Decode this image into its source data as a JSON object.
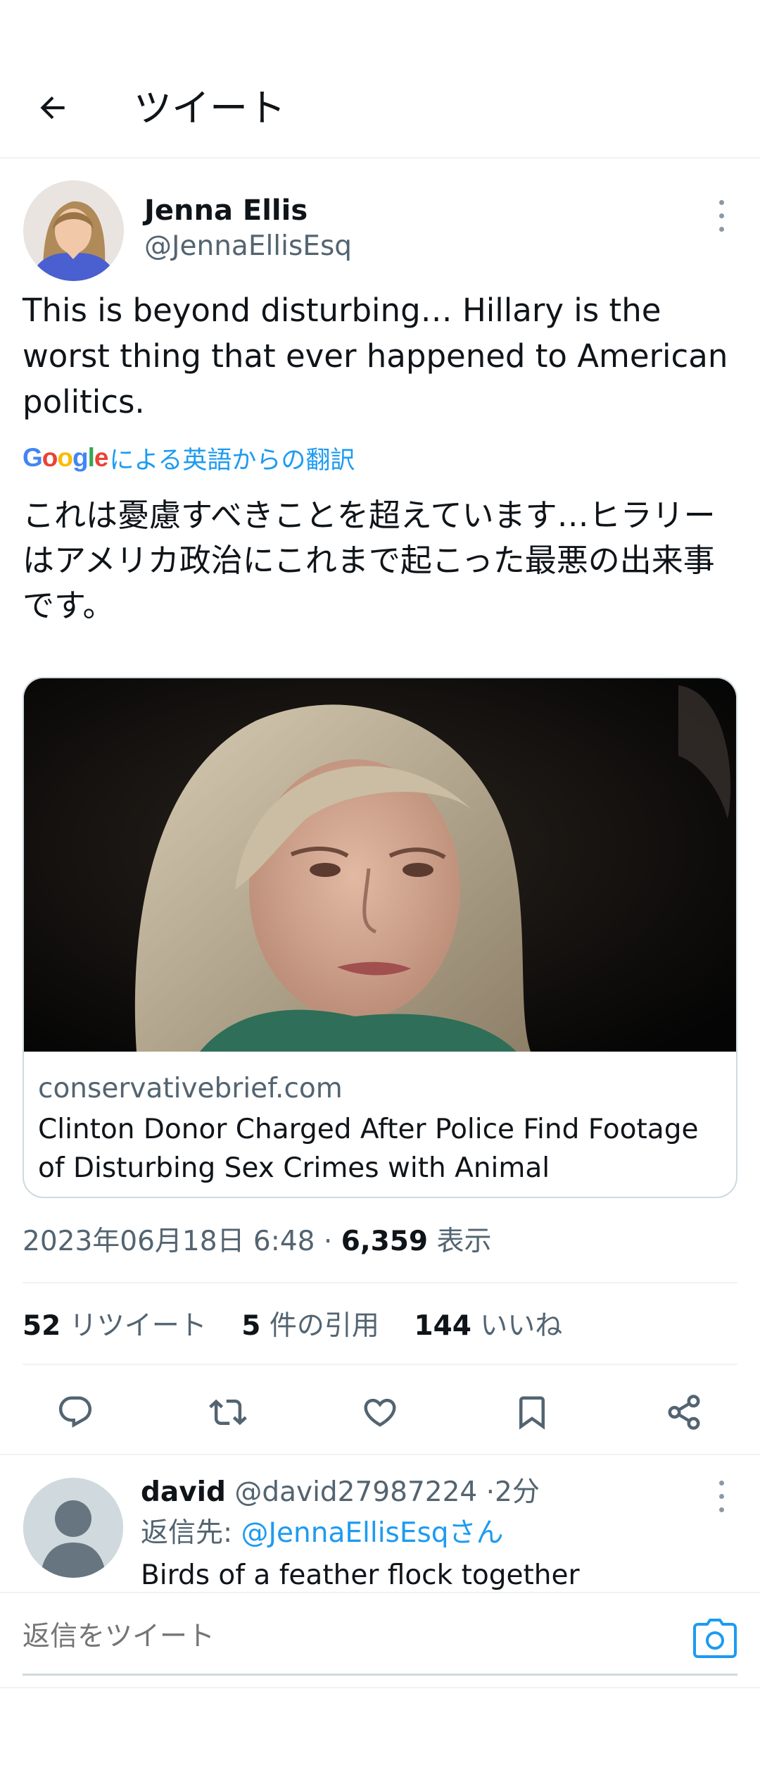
{
  "header": {
    "title": "ツイート"
  },
  "tweet": {
    "author_name": "Jenna Ellis",
    "author_handle": "@JennaEllisEsq",
    "text": "This is beyond disturbing… Hillary is the worst thing that ever happened to American politics.",
    "translate_brand": "Google",
    "translate_label": "による英語からの翻訳",
    "translation": "これは憂慮すべきことを超えています…ヒラリーはアメリカ政治にこれまで起こった最悪の出来事です。",
    "card": {
      "domain": "conservativebrief.com",
      "title": "Clinton Donor Charged After Police Find Footage of Disturbing Sex Crimes with Animal"
    },
    "timestamp": "2023年06月18日 6:48",
    "views_count": "6,359",
    "views_label": "表示",
    "stats": {
      "retweets_count": "52",
      "retweets_label": "リツイート",
      "quotes_count": "5",
      "quotes_label": "件の引用",
      "likes_count": "144",
      "likes_label": "いいね"
    }
  },
  "icons": {
    "actions": [
      "reply-icon",
      "retweet-icon",
      "like-icon",
      "bookmark-icon",
      "share-icon"
    ]
  },
  "reply": {
    "name": "david",
    "handle": "@david27987224",
    "time": "2分",
    "reply_to_prefix": "返信先: ",
    "reply_to_mention": "@JennaEllisEsqさん",
    "text": "Birds of a feather flock together"
  },
  "compose": {
    "placeholder": "返信をツイート"
  },
  "colors": {
    "accent": "#1d9bf0",
    "text_primary": "#0f1419",
    "text_secondary": "#536471",
    "divider": "#eff3f4"
  }
}
